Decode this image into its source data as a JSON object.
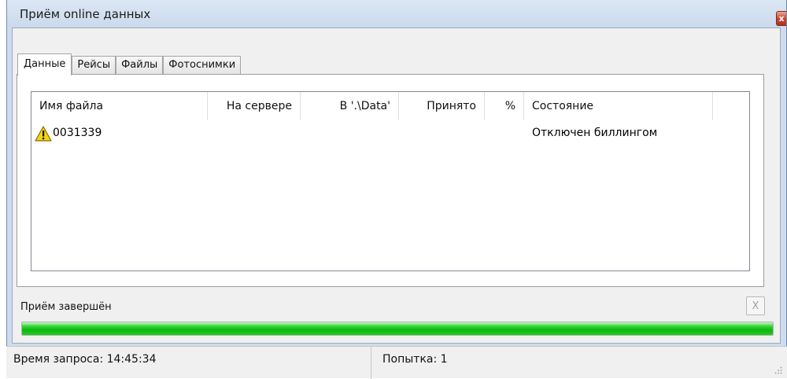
{
  "window": {
    "title": "Приём online данных",
    "close_label": "x"
  },
  "tabs": [
    {
      "label": "Данные",
      "active": true
    },
    {
      "label": "Рейсы",
      "active": false
    },
    {
      "label": "Файлы",
      "active": false
    },
    {
      "label": "Фотоснимки",
      "active": false
    }
  ],
  "table": {
    "columns": [
      "Имя файла",
      "На сервере",
      "В '.\\Data'",
      "Принято",
      "%",
      "Состояние"
    ],
    "rows": [
      {
        "icon": "warning-icon",
        "file_name": "0031339",
        "on_server": "",
        "in_data": "",
        "received": "",
        "percent": "",
        "state": "Отключен биллингом"
      }
    ]
  },
  "status": {
    "text": "Приём завершён",
    "cancel_label": "X",
    "progress_percent": 100
  },
  "statusbar": {
    "request_time": "Время запроса: 14:45:34",
    "attempt": "Попытка: 1"
  },
  "colors": {
    "progress": "#1ec21e",
    "titlebar": "#cfdcec",
    "close": "#c7412b"
  }
}
